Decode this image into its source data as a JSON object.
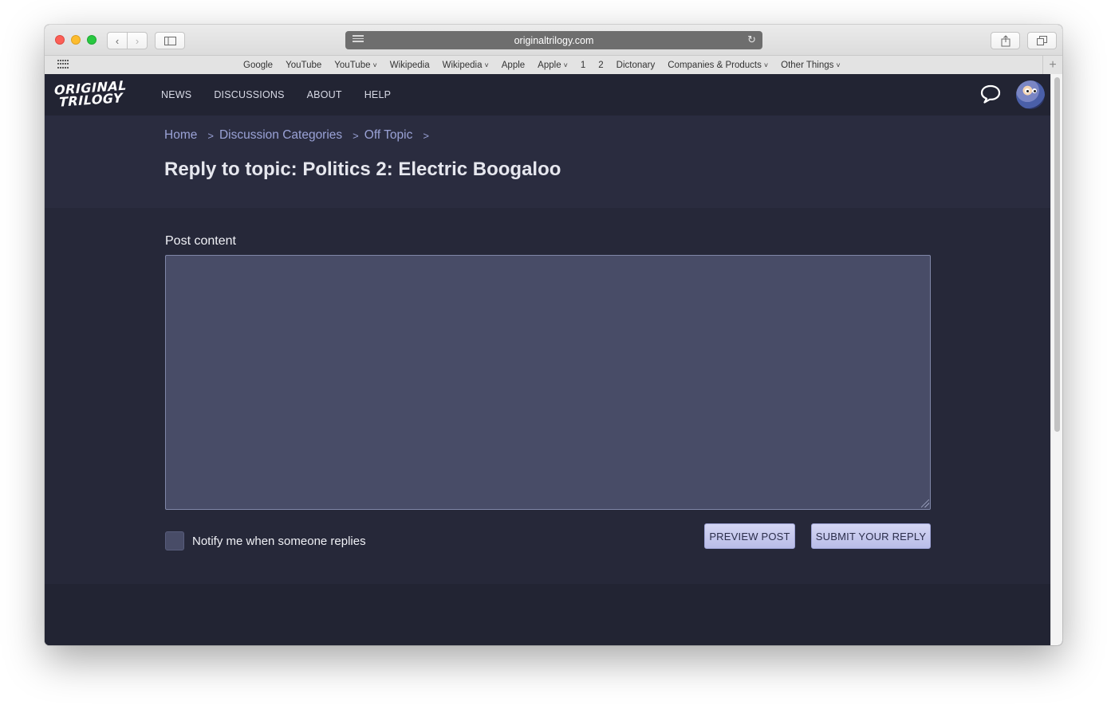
{
  "browser": {
    "url": "originaltrilogy.com",
    "favorites": [
      {
        "label": "Google",
        "dropdown": false
      },
      {
        "label": "YouTube",
        "dropdown": false
      },
      {
        "label": "YouTube",
        "dropdown": true
      },
      {
        "label": "Wikipedia",
        "dropdown": false
      },
      {
        "label": "Wikipedia",
        "dropdown": true
      },
      {
        "label": "Apple",
        "dropdown": false
      },
      {
        "label": "Apple",
        "dropdown": true
      },
      {
        "label": "1",
        "dropdown": false
      },
      {
        "label": "2",
        "dropdown": false
      },
      {
        "label": "Dictonary",
        "dropdown": false
      },
      {
        "label": "Companies & Products",
        "dropdown": true
      },
      {
        "label": "Other Things",
        "dropdown": true
      }
    ]
  },
  "site": {
    "logo_line1": "ORIGINAL",
    "logo_line2": "TRILOGY",
    "nav": [
      "NEWS",
      "DISCUSSIONS",
      "ABOUT",
      "HELP"
    ]
  },
  "breadcrumb": {
    "items": [
      "Home",
      "Discussion Categories",
      "Off Topic"
    ],
    "separator": ">"
  },
  "page_title": "Reply to topic: Politics 2: Electric Boogaloo",
  "form": {
    "post_label": "Post content",
    "post_value": "",
    "notify_label": "Notify me when someone replies",
    "notify_checked": false,
    "preview_label": "PREVIEW POST",
    "submit_label": "SUBMIT YOUR REPLY"
  },
  "colors": {
    "page_bg": "#222433",
    "accent_link": "#9aa2d6",
    "button_bg": "#c7caee",
    "textarea_bg": "#484c67"
  }
}
